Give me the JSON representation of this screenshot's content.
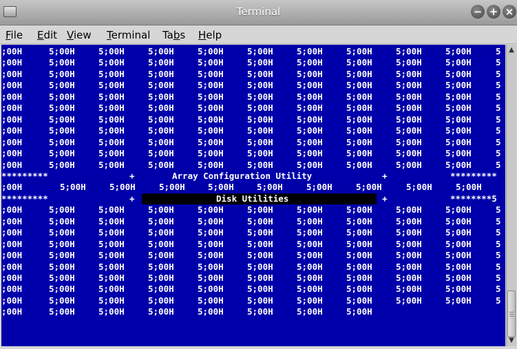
{
  "window": {
    "title": "Terminal"
  },
  "menu": [
    {
      "label": "File",
      "u": "F",
      "rest": "ile"
    },
    {
      "label": "Edit",
      "u": "E",
      "rest": "dit"
    },
    {
      "label": "View",
      "u": "V",
      "rest": "iew"
    },
    {
      "label": "Terminal",
      "u": "T",
      "rest": "erminal"
    },
    {
      "label": "Tabs",
      "pre": "Ta",
      "u": "b",
      "rest": "s"
    },
    {
      "label": "Help",
      "u": "H",
      "rest": "elp"
    }
  ],
  "terminal": {
    "cell": "5;00H",
    "first_cell": ";00H",
    "edge_char": "5",
    "star_row": {
      "left": "*********",
      "plus1": "+",
      "title": "Array Configuration Utility",
      "plus2": "+",
      "right": "*********"
    },
    "star_row2": {
      "left": "*********",
      "plus1": "+",
      "title": "Disk Utilities",
      "plus2": "+",
      "right": "********5"
    }
  }
}
